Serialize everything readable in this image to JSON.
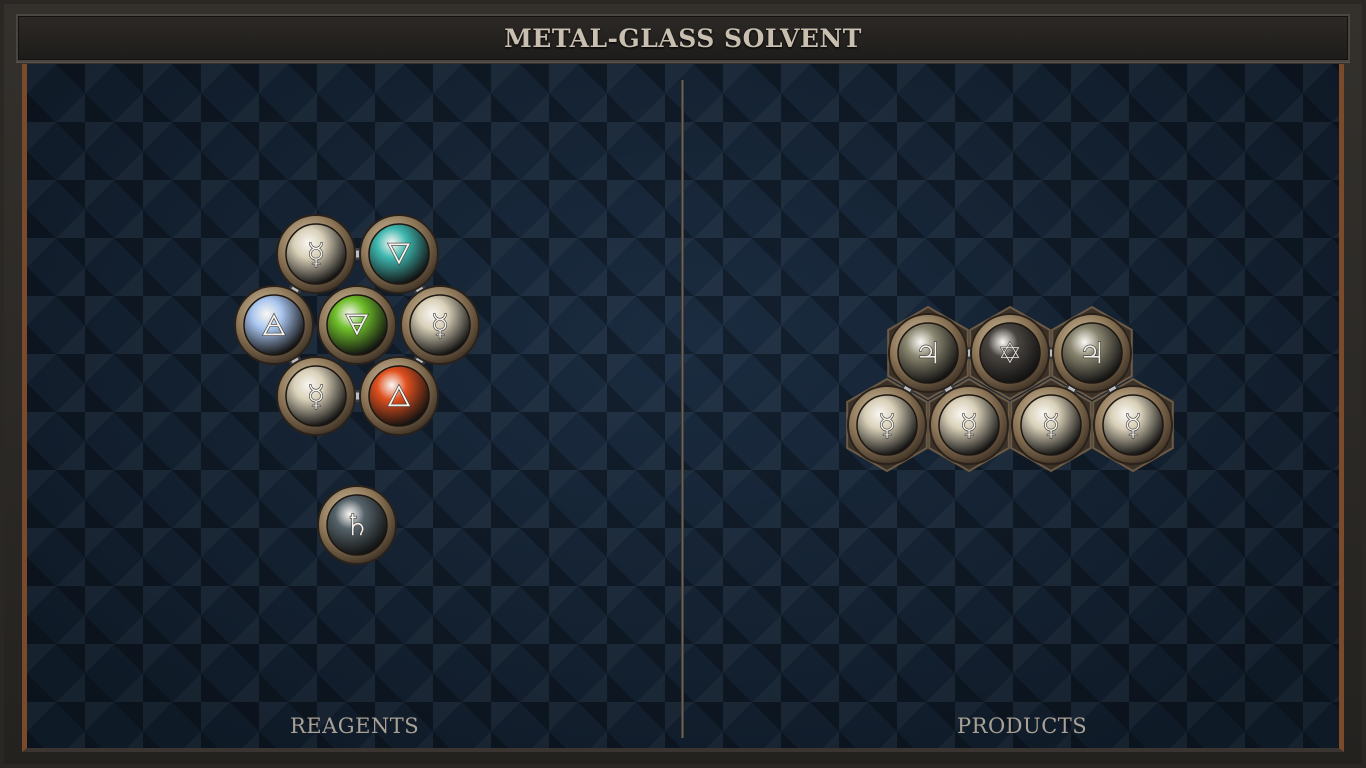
{
  "title": "METAL-GLASS SOLVENT",
  "reagents_label": "REAGENTS",
  "products_label": "PRODUCTS",
  "reagents": {
    "molecule_1": {
      "atoms": [
        {
          "id": "a1",
          "element": "quicksilver",
          "symbol": "☿",
          "color": "#d9d0b8"
        },
        {
          "id": "a2",
          "element": "water",
          "symbol": "🜄",
          "color": "#3fb8b0"
        },
        {
          "id": "a3",
          "element": "air",
          "symbol": "🜁",
          "color": "#a9c6f0"
        },
        {
          "id": "a4",
          "element": "earth",
          "symbol": "🜃",
          "color": "#6fbf2a"
        },
        {
          "id": "a5",
          "element": "quicksilver",
          "symbol": "☿",
          "color": "#d9d0b8"
        },
        {
          "id": "a6",
          "element": "quicksilver",
          "symbol": "☿",
          "color": "#d9d0b8"
        },
        {
          "id": "a7",
          "element": "fire",
          "symbol": "🜂",
          "color": "#e0501e"
        }
      ],
      "bonds": [
        [
          "a1",
          "a2"
        ],
        [
          "a1",
          "a3"
        ],
        [
          "a2",
          "a5"
        ],
        [
          "a3",
          "a6"
        ],
        [
          "a5",
          "a7"
        ],
        [
          "a6",
          "a7"
        ]
      ]
    },
    "molecule_2": {
      "atoms": [
        {
          "id": "b1",
          "element": "lead",
          "symbol": "♄",
          "color": "#55636a"
        }
      ],
      "bonds": []
    }
  },
  "products": {
    "molecule_1": {
      "atoms": [
        {
          "id": "c1",
          "element": "tin",
          "symbol": "♃",
          "color": "#8a8670"
        },
        {
          "id": "c2",
          "element": "salt",
          "symbol": "✡",
          "color": "#4a4540"
        },
        {
          "id": "c3",
          "element": "tin",
          "symbol": "♃",
          "color": "#8a8670"
        },
        {
          "id": "c4",
          "element": "quicksilver",
          "symbol": "☿",
          "color": "#d9d0b8"
        },
        {
          "id": "c5",
          "element": "quicksilver",
          "symbol": "☿",
          "color": "#d9d0b8"
        },
        {
          "id": "c6",
          "element": "quicksilver",
          "symbol": "☿",
          "color": "#d9d0b8"
        },
        {
          "id": "c7",
          "element": "quicksilver",
          "symbol": "☿",
          "color": "#d9d0b8"
        }
      ],
      "bonds": [
        [
          "c1",
          "c2"
        ],
        [
          "c2",
          "c3"
        ],
        [
          "c1",
          "c4"
        ],
        [
          "c1",
          "c5"
        ],
        [
          "c3",
          "c6"
        ],
        [
          "c3",
          "c7"
        ]
      ]
    }
  }
}
